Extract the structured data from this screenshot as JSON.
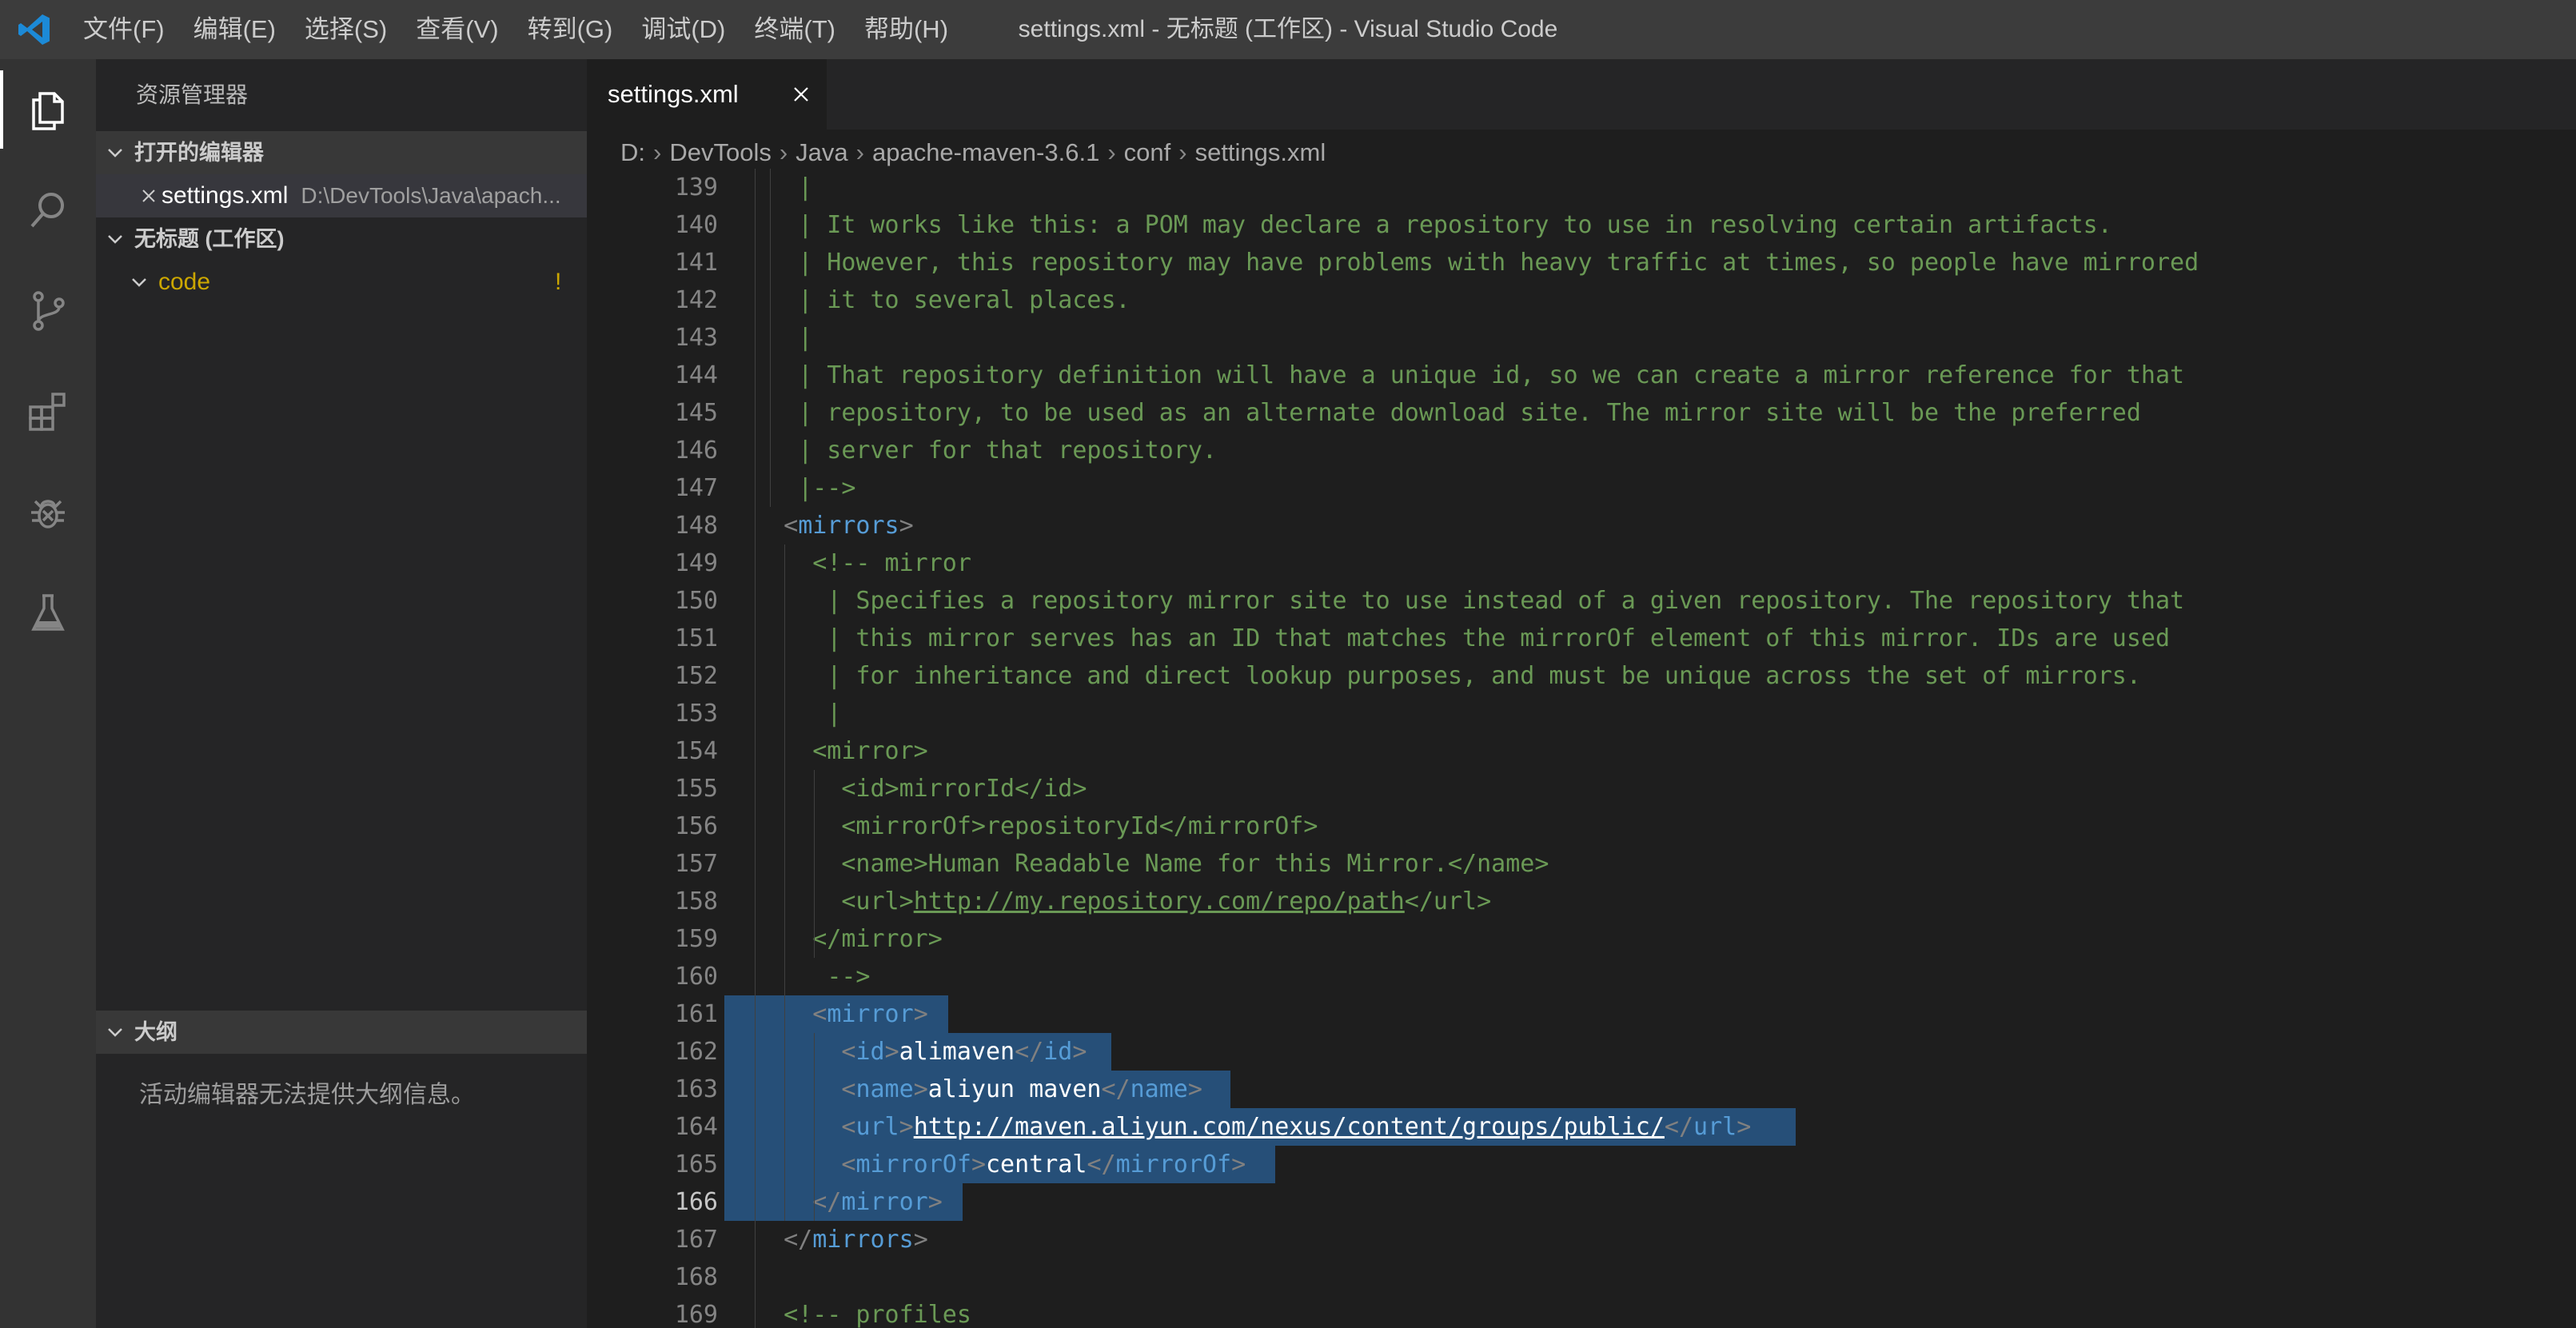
{
  "window": {
    "title": "settings.xml - 无标题 (工作区) - Visual Studio Code"
  },
  "menu": [
    "文件(F)",
    "编辑(E)",
    "选择(S)",
    "查看(V)",
    "转到(G)",
    "调试(D)",
    "终端(T)",
    "帮助(H)"
  ],
  "activity_bar": [
    "explorer-icon",
    "search-icon",
    "source-control-icon",
    "extensions-icon",
    "debug-icon",
    "test-flask-icon"
  ],
  "sidebar": {
    "title": "资源管理器",
    "open_editors": {
      "header": "打开的编辑器",
      "items": [
        {
          "name": "settings.xml",
          "path": "D:\\DevTools\\Java\\apach..."
        }
      ]
    },
    "workspace": {
      "header": "无标题 (工作区)",
      "folders": [
        {
          "name": "code",
          "badge": "!"
        }
      ]
    },
    "outline": {
      "header": "大纲",
      "message": "活动编辑器无法提供大纲信息。"
    }
  },
  "editor": {
    "tab": {
      "label": "settings.xml"
    },
    "breadcrumb": [
      "D:",
      "DevTools",
      "Java",
      "apache-maven-3.6.1",
      "conf",
      "settings.xml"
    ],
    "current_line": 166,
    "lines": [
      {
        "n": 139,
        "text": "   |",
        "kind": "comment"
      },
      {
        "n": 140,
        "text": "   | It works like this: a POM may declare a repository to use in resolving certain artifacts.",
        "kind": "comment"
      },
      {
        "n": 141,
        "text": "   | However, this repository may have problems with heavy traffic at times, so people have mirrored",
        "kind": "comment"
      },
      {
        "n": 142,
        "text": "   | it to several places.",
        "kind": "comment"
      },
      {
        "n": 143,
        "text": "   |",
        "kind": "comment"
      },
      {
        "n": 144,
        "text": "   | That repository definition will have a unique id, so we can create a mirror reference for that",
        "kind": "comment"
      },
      {
        "n": 145,
        "text": "   | repository, to be used as an alternate download site. The mirror site will be the preferred",
        "kind": "comment"
      },
      {
        "n": 146,
        "text": "   | server for that repository.",
        "kind": "comment"
      },
      {
        "n": 147,
        "text": "   |-->",
        "kind": "comment"
      },
      {
        "n": 148,
        "text": "  <mirrors>",
        "kind": "open-tag"
      },
      {
        "n": 149,
        "text": "    <!-- mirror",
        "kind": "comment"
      },
      {
        "n": 150,
        "text": "     | Specifies a repository mirror site to use instead of a given repository. The repository that",
        "kind": "comment"
      },
      {
        "n": 151,
        "text": "     | this mirror serves has an ID that matches the mirrorOf element of this mirror. IDs are used",
        "kind": "comment"
      },
      {
        "n": 152,
        "text": "     | for inheritance and direct lookup purposes, and must be unique across the set of mirrors.",
        "kind": "comment"
      },
      {
        "n": 153,
        "text": "     |",
        "kind": "comment"
      },
      {
        "n": 154,
        "text": "    <mirror>",
        "kind": "comment"
      },
      {
        "n": 155,
        "text": "      <id>mirrorId</id>",
        "kind": "comment"
      },
      {
        "n": 156,
        "text": "      <mirrorOf>repositoryId</mirrorOf>",
        "kind": "comment"
      },
      {
        "n": 157,
        "text": "      <name>Human Readable Name for this Mirror.</name>",
        "kind": "comment"
      },
      {
        "n": 158,
        "text": "      <url>http://my.repository.com/repo/path</url>",
        "kind": "comment-url"
      },
      {
        "n": 159,
        "text": "    </mirror>",
        "kind": "comment"
      },
      {
        "n": 160,
        "text": "     -->",
        "kind": "comment"
      },
      {
        "n": 161,
        "text": "    <mirror>",
        "kind": "sel-tag"
      },
      {
        "n": 162,
        "text": "      <id>alimaven</id>",
        "kind": "sel-element"
      },
      {
        "n": 163,
        "text": "      <name>aliyun maven</name>",
        "kind": "sel-element"
      },
      {
        "n": 164,
        "text": "      <url>http://maven.aliyun.com/nexus/content/groups/public/</url>",
        "kind": "sel-url"
      },
      {
        "n": 165,
        "text": "      <mirrorOf>central</mirrorOf>",
        "kind": "sel-element"
      },
      {
        "n": 166,
        "text": "    </mirror>",
        "kind": "sel-tag"
      },
      {
        "n": 167,
        "text": "  </mirrors>",
        "kind": "close-tag"
      },
      {
        "n": 168,
        "text": "",
        "kind": "blank"
      },
      {
        "n": 169,
        "text": "  <!-- profiles",
        "kind": "comment"
      }
    ]
  },
  "colors": {
    "accent": "#007acc",
    "comment": "#6a9955",
    "tag": "#569cd6",
    "selection": "#264f78",
    "warning": "#cca700"
  }
}
